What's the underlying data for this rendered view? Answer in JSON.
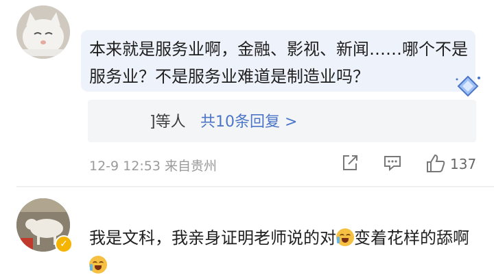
{
  "comment1": {
    "text": "本来就是服务业啊，金融、影视、新闻……哪个不是服务业？不是服务业难道是制造业吗？",
    "replies": {
      "prefix": "]等人",
      "link": "共10条回复 >"
    },
    "meta": "12-9 12:53 来自贵州",
    "likes": "137"
  },
  "comment2": {
    "text_a": "我是文科，我亲身证明老师说的对",
    "text_b": "变着花样的舔啊"
  },
  "icons": {
    "share": "share-icon",
    "comment": "comment-icon",
    "like": "thumbs-up-icon",
    "verified": "verified-badge-icon",
    "emoji": "laugh-cry-emoji"
  },
  "colors": {
    "link": "#4a75c8",
    "bubble": "#eef2fb",
    "badge": "#f5b400"
  }
}
